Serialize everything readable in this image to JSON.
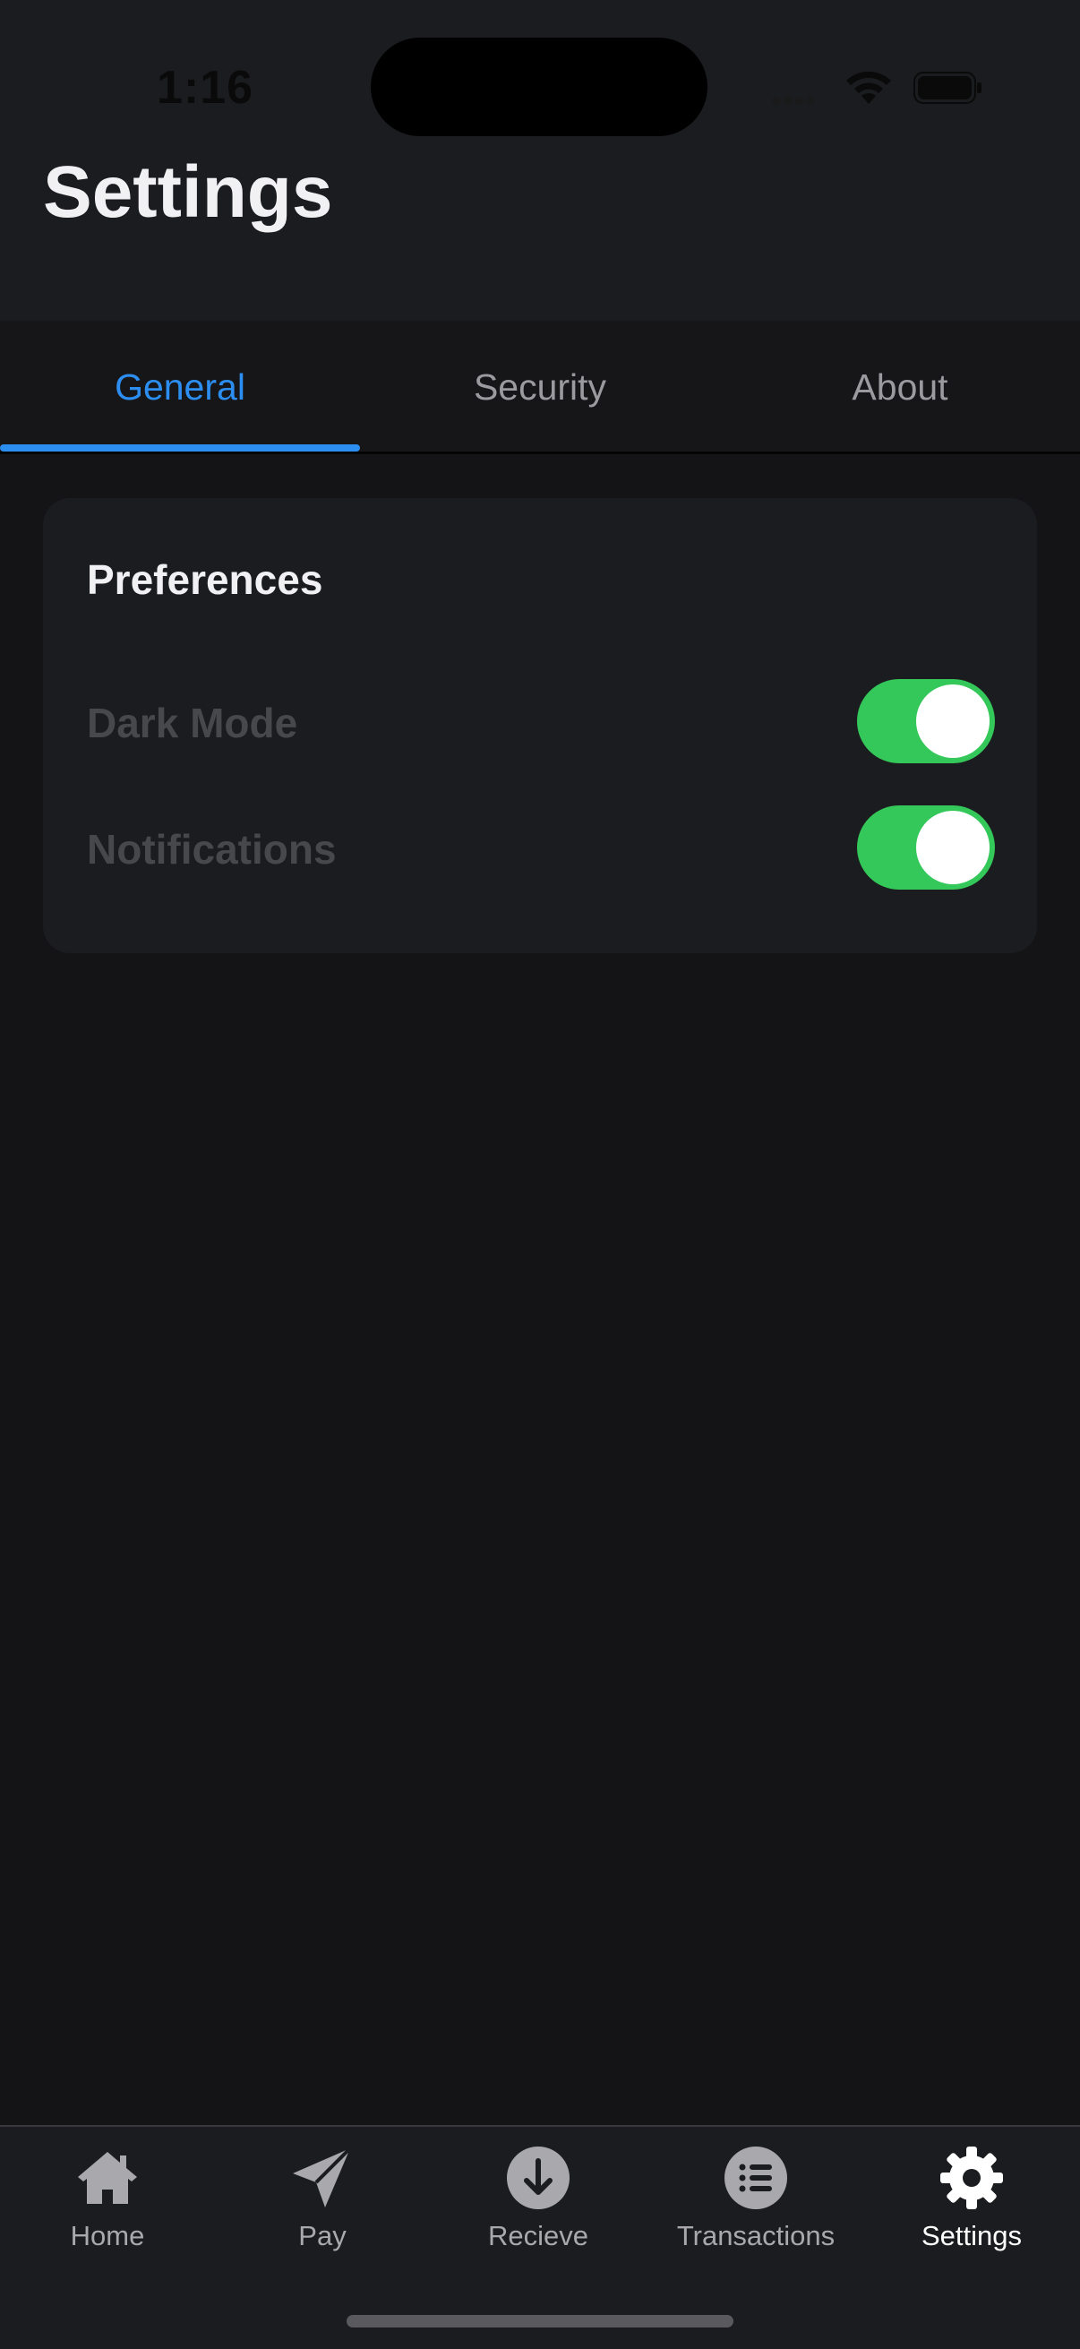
{
  "status_bar": {
    "time": "1:16",
    "icons": [
      "cellular-signal-icon",
      "wifi-icon",
      "battery-icon"
    ]
  },
  "header": {
    "title": "Settings"
  },
  "tabs": [
    {
      "label": "General",
      "active": true
    },
    {
      "label": "Security",
      "active": false
    },
    {
      "label": "About",
      "active": false
    }
  ],
  "preferences": {
    "title": "Preferences",
    "items": [
      {
        "label": "Dark Mode",
        "enabled": true
      },
      {
        "label": "Notifications",
        "enabled": true
      }
    ]
  },
  "tab_bar": {
    "items": [
      {
        "label": "Home",
        "icon": "home-icon",
        "active": false
      },
      {
        "label": "Pay",
        "icon": "paper-plane-icon",
        "active": false
      },
      {
        "label": "Recieve",
        "icon": "arrow-down-circle-icon",
        "active": false
      },
      {
        "label": "Transactions",
        "icon": "list-circle-icon",
        "active": false
      },
      {
        "label": "Settings",
        "icon": "gear-icon",
        "active": true
      }
    ]
  },
  "colors": {
    "accent": "#2c8ef0",
    "toggle_on": "#34c759",
    "background": "#141416",
    "card": "#1b1c1f"
  }
}
